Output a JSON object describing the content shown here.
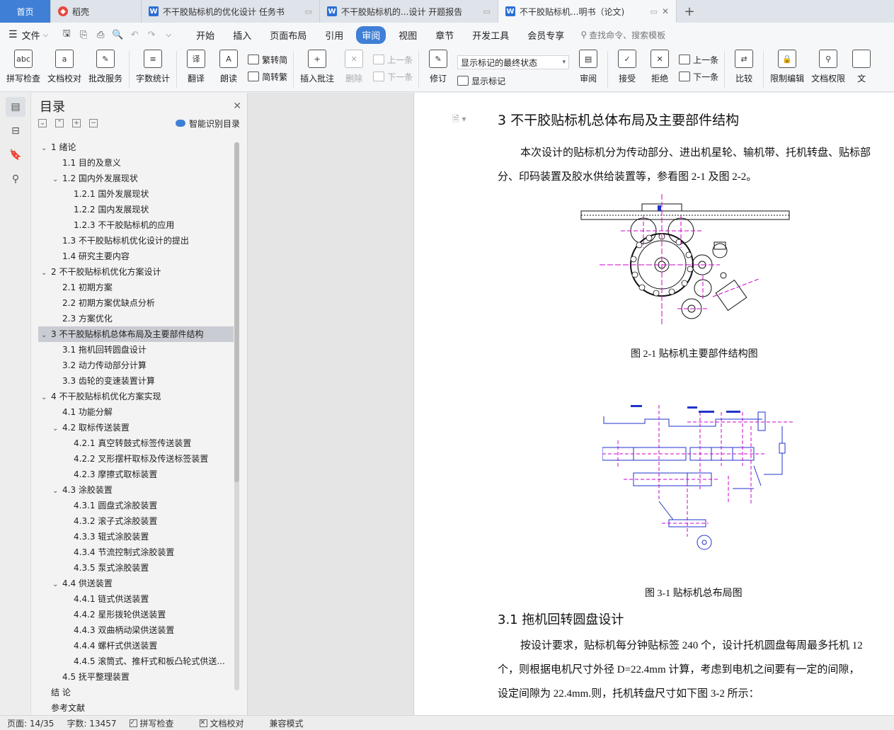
{
  "tabs": [
    {
      "label": "首页",
      "type": "home"
    },
    {
      "label": "稻壳",
      "type": "daoke"
    },
    {
      "label": "不干胶贴标机的优化设计 任务书",
      "type": "doc"
    },
    {
      "label": "不干胶贴标机的...设计 开题报告",
      "type": "doc"
    },
    {
      "label": "不干胶贴标机...明书（论文)",
      "type": "doc",
      "active": true
    }
  ],
  "menu": {
    "file": "文件",
    "items": [
      "开始",
      "插入",
      "页面布局",
      "引用",
      "审阅",
      "视图",
      "章节",
      "开发工具",
      "会员专享"
    ],
    "active": "审阅",
    "search": "查找命令、搜索模板"
  },
  "ribbon": {
    "spell": "拼写检查",
    "proof": "文档校对",
    "correct": "批改服务",
    "count": "字数统计",
    "translate": "翻译",
    "read": "朗读",
    "trad": "繁转简",
    "simp": "简转繁",
    "insert_comment": "插入批注",
    "delete": "删除",
    "prev_comment": "上一条",
    "next_comment": "下一条",
    "revise": "修订",
    "display_state": "显示标记的最终状态",
    "show_marks": "显示标记",
    "review": "审阅",
    "accept": "接受",
    "reject": "拒绝",
    "prev_change": "上一条",
    "next_change": "下一条",
    "compare": "比较",
    "restrict": "限制编辑",
    "perm": "文档权限",
    "more": "文"
  },
  "toc": {
    "title": "目录",
    "smart": "智能识别目录",
    "items": [
      {
        "text": "1 绪论",
        "level": 0,
        "caret": true
      },
      {
        "text": "1.1 目的及意义",
        "level": 1
      },
      {
        "text": "1.2 国内外发展现状",
        "level": 1,
        "caret": true
      },
      {
        "text": "1.2.1 国外发展现状",
        "level": 2
      },
      {
        "text": "1.2.2 国内发展现状",
        "level": 2
      },
      {
        "text": "1.2.3 不干胶贴标机的应用",
        "level": 2
      },
      {
        "text": "1.3 不干胶贴标机优化设计的提出",
        "level": 1
      },
      {
        "text": "1.4 研究主要内容",
        "level": 1
      },
      {
        "text": "2 不干胶贴标机优化方案设计",
        "level": 0,
        "caret": true
      },
      {
        "text": "2.1  初期方案",
        "level": 1
      },
      {
        "text": "2.2  初期方案优缺点分析",
        "level": 1
      },
      {
        "text": "2.3  方案优化",
        "level": 1
      },
      {
        "text": "3 不干胶贴标机总体布局及主要部件结构",
        "level": 0,
        "caret": true,
        "selected": true
      },
      {
        "text": "3.1 拖机回转圆盘设计",
        "level": 1
      },
      {
        "text": "3.2 动力传动部分计算",
        "level": 1
      },
      {
        "text": "3.3 齿轮的变速装置计算",
        "level": 1
      },
      {
        "text": "4 不干胶贴标机优化方案实现",
        "level": 0,
        "caret": true
      },
      {
        "text": "4.1  功能分解",
        "level": 1
      },
      {
        "text": "4.2  取标传送装置",
        "level": 1,
        "caret": true
      },
      {
        "text": "4.2.1  真空转鼓式标签传送装置",
        "level": 2
      },
      {
        "text": "4.2.2  叉形摆杆取标及传送标签装置",
        "level": 2
      },
      {
        "text": "4.2.3  摩擦式取标装置",
        "level": 2
      },
      {
        "text": "4.3  涂胶装置",
        "level": 1,
        "caret": true
      },
      {
        "text": "4.3.1  圆盘式涂胶装置",
        "level": 2
      },
      {
        "text": "4.3.2  滚子式涂胶装置",
        "level": 2
      },
      {
        "text": "4.3.3  辊式涂胶装置",
        "level": 2
      },
      {
        "text": "4.3.4 节流控制式涂胶装置",
        "level": 2
      },
      {
        "text": "4.3.5  泵式涂胶装置",
        "level": 2
      },
      {
        "text": "4.4  供送装置",
        "level": 1,
        "caret": true
      },
      {
        "text": "4.4.1  链式供送装置",
        "level": 2
      },
      {
        "text": "4.4.2  星形拨轮供送装置",
        "level": 2
      },
      {
        "text": "4.4.3  双曲柄动梁供送装置",
        "level": 2
      },
      {
        "text": "4.4.4  螺杆式供送装置",
        "level": 2
      },
      {
        "text": "4.4.5  滚筒式、推杆式和板凸轮式供送...",
        "level": 2
      },
      {
        "text": "4.5  抚平整理装置",
        "level": 1
      },
      {
        "text": "结    论",
        "level": 0
      },
      {
        "text": "参考文献",
        "level": 0
      }
    ]
  },
  "doc": {
    "heading1": "3 不干胶贴标机总体布局及主要部件结构",
    "para1_line1": "本次设计的贴标机分为传动部分、进出机星轮、输机带、托机转盘、贴标部",
    "para1_line2": "分、印码装置及胶水供给装置等，参看图 2-1 及图 2-2。",
    "fig1_caption": "图 2-1 贴标机主要部件结构图",
    "fig2_caption": "图 3-1 贴标机总布局图",
    "heading2": "3.1 拖机回转圆盘设计",
    "para2_line1": "按设计要求，贴标机每分钟贴标签 240 个，设计托机圆盘每周最多托机 12",
    "para2_line2": "个，则根据电机尺寸外径 D=22.4mm 计算，考虑到电机之间要有一定的间隙，",
    "para2_line3": "设定间隙为 22.4mm.则，托机转盘尺寸如下图 3-2 所示："
  },
  "status": {
    "page": "页面: 14/35",
    "words": "字数: 13457",
    "spell": "拼写检查",
    "proof": "文档校对",
    "compat": "兼容模式"
  },
  "colors": {
    "accent": "#3f7fd6",
    "magenta": "#cc00cc",
    "blue_line": "#2233cc"
  }
}
